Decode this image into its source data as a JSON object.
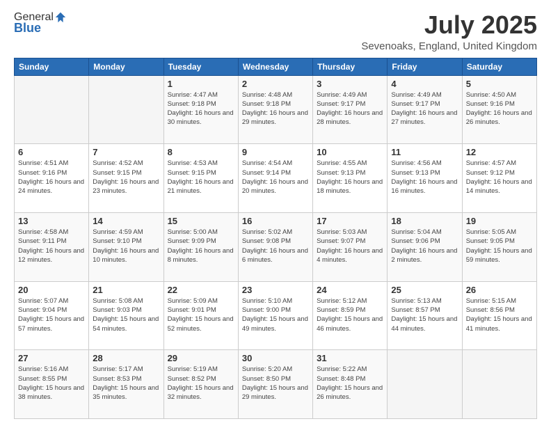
{
  "header": {
    "logo_general": "General",
    "logo_blue": "Blue",
    "title": "July 2025",
    "subtitle": "Sevenoaks, England, United Kingdom"
  },
  "days_of_week": [
    "Sunday",
    "Monday",
    "Tuesday",
    "Wednesday",
    "Thursday",
    "Friday",
    "Saturday"
  ],
  "weeks": [
    [
      {
        "day": "",
        "info": ""
      },
      {
        "day": "",
        "info": ""
      },
      {
        "day": "1",
        "sunrise": "Sunrise: 4:47 AM",
        "sunset": "Sunset: 9:18 PM",
        "daylight": "Daylight: 16 hours and 30 minutes."
      },
      {
        "day": "2",
        "sunrise": "Sunrise: 4:48 AM",
        "sunset": "Sunset: 9:18 PM",
        "daylight": "Daylight: 16 hours and 29 minutes."
      },
      {
        "day": "3",
        "sunrise": "Sunrise: 4:49 AM",
        "sunset": "Sunset: 9:17 PM",
        "daylight": "Daylight: 16 hours and 28 minutes."
      },
      {
        "day": "4",
        "sunrise": "Sunrise: 4:49 AM",
        "sunset": "Sunset: 9:17 PM",
        "daylight": "Daylight: 16 hours and 27 minutes."
      },
      {
        "day": "5",
        "sunrise": "Sunrise: 4:50 AM",
        "sunset": "Sunset: 9:16 PM",
        "daylight": "Daylight: 16 hours and 26 minutes."
      }
    ],
    [
      {
        "day": "6",
        "sunrise": "Sunrise: 4:51 AM",
        "sunset": "Sunset: 9:16 PM",
        "daylight": "Daylight: 16 hours and 24 minutes."
      },
      {
        "day": "7",
        "sunrise": "Sunrise: 4:52 AM",
        "sunset": "Sunset: 9:15 PM",
        "daylight": "Daylight: 16 hours and 23 minutes."
      },
      {
        "day": "8",
        "sunrise": "Sunrise: 4:53 AM",
        "sunset": "Sunset: 9:15 PM",
        "daylight": "Daylight: 16 hours and 21 minutes."
      },
      {
        "day": "9",
        "sunrise": "Sunrise: 4:54 AM",
        "sunset": "Sunset: 9:14 PM",
        "daylight": "Daylight: 16 hours and 20 minutes."
      },
      {
        "day": "10",
        "sunrise": "Sunrise: 4:55 AM",
        "sunset": "Sunset: 9:13 PM",
        "daylight": "Daylight: 16 hours and 18 minutes."
      },
      {
        "day": "11",
        "sunrise": "Sunrise: 4:56 AM",
        "sunset": "Sunset: 9:13 PM",
        "daylight": "Daylight: 16 hours and 16 minutes."
      },
      {
        "day": "12",
        "sunrise": "Sunrise: 4:57 AM",
        "sunset": "Sunset: 9:12 PM",
        "daylight": "Daylight: 16 hours and 14 minutes."
      }
    ],
    [
      {
        "day": "13",
        "sunrise": "Sunrise: 4:58 AM",
        "sunset": "Sunset: 9:11 PM",
        "daylight": "Daylight: 16 hours and 12 minutes."
      },
      {
        "day": "14",
        "sunrise": "Sunrise: 4:59 AM",
        "sunset": "Sunset: 9:10 PM",
        "daylight": "Daylight: 16 hours and 10 minutes."
      },
      {
        "day": "15",
        "sunrise": "Sunrise: 5:00 AM",
        "sunset": "Sunset: 9:09 PM",
        "daylight": "Daylight: 16 hours and 8 minutes."
      },
      {
        "day": "16",
        "sunrise": "Sunrise: 5:02 AM",
        "sunset": "Sunset: 9:08 PM",
        "daylight": "Daylight: 16 hours and 6 minutes."
      },
      {
        "day": "17",
        "sunrise": "Sunrise: 5:03 AM",
        "sunset": "Sunset: 9:07 PM",
        "daylight": "Daylight: 16 hours and 4 minutes."
      },
      {
        "day": "18",
        "sunrise": "Sunrise: 5:04 AM",
        "sunset": "Sunset: 9:06 PM",
        "daylight": "Daylight: 16 hours and 2 minutes."
      },
      {
        "day": "19",
        "sunrise": "Sunrise: 5:05 AM",
        "sunset": "Sunset: 9:05 PM",
        "daylight": "Daylight: 15 hours and 59 minutes."
      }
    ],
    [
      {
        "day": "20",
        "sunrise": "Sunrise: 5:07 AM",
        "sunset": "Sunset: 9:04 PM",
        "daylight": "Daylight: 15 hours and 57 minutes."
      },
      {
        "day": "21",
        "sunrise": "Sunrise: 5:08 AM",
        "sunset": "Sunset: 9:03 PM",
        "daylight": "Daylight: 15 hours and 54 minutes."
      },
      {
        "day": "22",
        "sunrise": "Sunrise: 5:09 AM",
        "sunset": "Sunset: 9:01 PM",
        "daylight": "Daylight: 15 hours and 52 minutes."
      },
      {
        "day": "23",
        "sunrise": "Sunrise: 5:10 AM",
        "sunset": "Sunset: 9:00 PM",
        "daylight": "Daylight: 15 hours and 49 minutes."
      },
      {
        "day": "24",
        "sunrise": "Sunrise: 5:12 AM",
        "sunset": "Sunset: 8:59 PM",
        "daylight": "Daylight: 15 hours and 46 minutes."
      },
      {
        "day": "25",
        "sunrise": "Sunrise: 5:13 AM",
        "sunset": "Sunset: 8:57 PM",
        "daylight": "Daylight: 15 hours and 44 minutes."
      },
      {
        "day": "26",
        "sunrise": "Sunrise: 5:15 AM",
        "sunset": "Sunset: 8:56 PM",
        "daylight": "Daylight: 15 hours and 41 minutes."
      }
    ],
    [
      {
        "day": "27",
        "sunrise": "Sunrise: 5:16 AM",
        "sunset": "Sunset: 8:55 PM",
        "daylight": "Daylight: 15 hours and 38 minutes."
      },
      {
        "day": "28",
        "sunrise": "Sunrise: 5:17 AM",
        "sunset": "Sunset: 8:53 PM",
        "daylight": "Daylight: 15 hours and 35 minutes."
      },
      {
        "day": "29",
        "sunrise": "Sunrise: 5:19 AM",
        "sunset": "Sunset: 8:52 PM",
        "daylight": "Daylight: 15 hours and 32 minutes."
      },
      {
        "day": "30",
        "sunrise": "Sunrise: 5:20 AM",
        "sunset": "Sunset: 8:50 PM",
        "daylight": "Daylight: 15 hours and 29 minutes."
      },
      {
        "day": "31",
        "sunrise": "Sunrise: 5:22 AM",
        "sunset": "Sunset: 8:48 PM",
        "daylight": "Daylight: 15 hours and 26 minutes."
      },
      {
        "day": "",
        "info": ""
      },
      {
        "day": "",
        "info": ""
      }
    ]
  ]
}
